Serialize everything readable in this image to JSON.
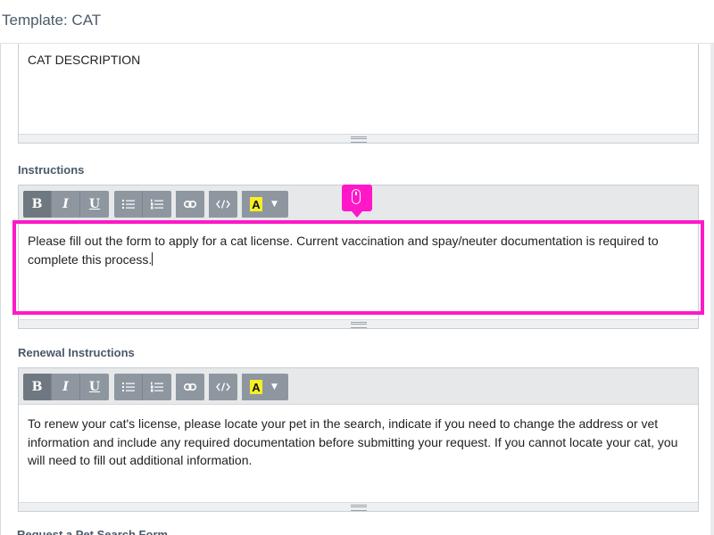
{
  "window": {
    "title": "Template: CAT"
  },
  "description": {
    "value": "CAT DESCRIPTION"
  },
  "instructions": {
    "label": "Instructions",
    "text": "Please fill out the form to apply for a cat license. Current vaccination and spay/neuter documentation is required to complete this process."
  },
  "renewal": {
    "label": "Renewal Instructions",
    "text": "To renew your cat's license, please locate your pet in the search, indicate if you need to change the address or vet information and include any required documentation before submitting your request. If you cannot locate your cat, you will need to fill out additional information."
  },
  "toolbar": {
    "bold": "B",
    "italic": "I",
    "underline": "U",
    "highlight": "A"
  },
  "next_section": {
    "label": "Request a Pet Search Form"
  },
  "colors": {
    "focus": "#ff18c8",
    "label": "#4a5968",
    "toolbar_button": "#8e979f"
  },
  "icons": [
    "bold-icon",
    "italic-icon",
    "underline-icon",
    "bullet-list-icon",
    "numbered-list-icon",
    "link-icon",
    "code-icon",
    "highlight-icon",
    "chevron-down-icon",
    "mouse-icon",
    "resize-grip-icon"
  ]
}
